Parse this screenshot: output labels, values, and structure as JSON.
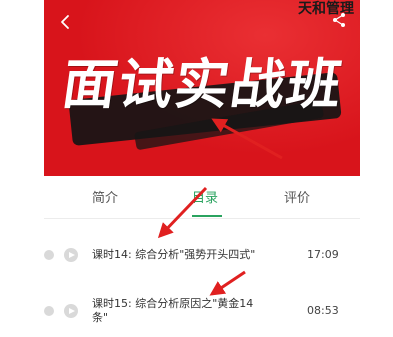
{
  "banner": {
    "title": "面试实战班",
    "brand": "天和管理",
    "background_color": "#d8141b"
  },
  "nav": {
    "back_icon": "chevron-left-icon",
    "share_icon": "share-icon"
  },
  "tabs": [
    {
      "label": "简介",
      "active": false
    },
    {
      "label": "目录",
      "active": true
    },
    {
      "label": "评价",
      "active": false
    }
  ],
  "accent_color": "#2aa35f",
  "lessons": [
    {
      "title": "课时14: 综合分析\"强势开头四式\"",
      "duration": "17:09"
    },
    {
      "title_line1": "课时15: 综合分析原因之\"黄金14",
      "title_line2": "条\"",
      "duration": "08:53"
    }
  ],
  "annotation_color": "#e02020"
}
